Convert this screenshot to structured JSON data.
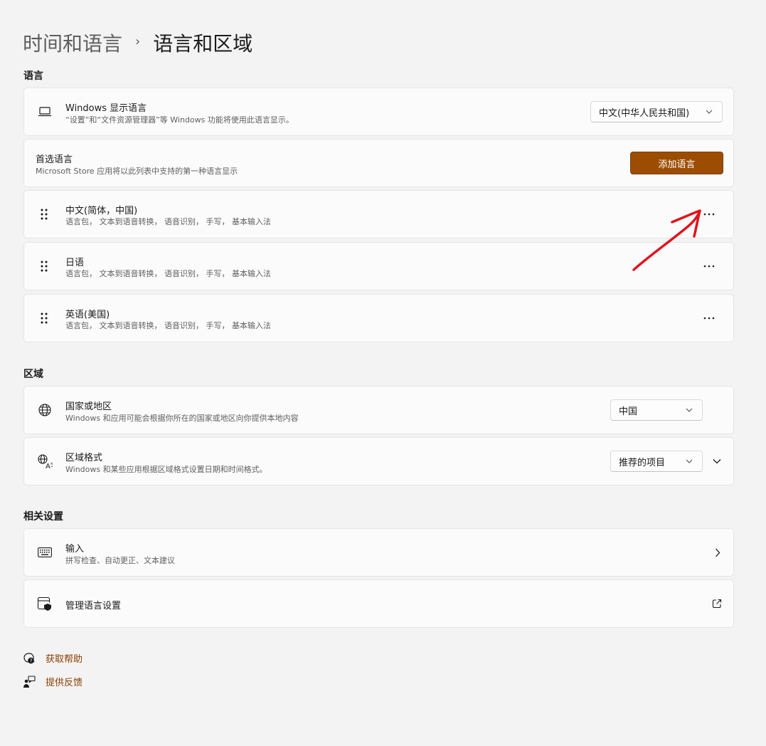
{
  "breadcrumb": {
    "parent": "时间和语言",
    "separator": "›",
    "current": "语言和区域"
  },
  "sections": {
    "language": "语言",
    "region": "区域",
    "related": "相关设置"
  },
  "windows_display_language": {
    "title": "Windows 显示语言",
    "desc": "“设置”和“文件资源管理器”等 Windows 功能将使用此语言显示。",
    "value": "中文(中华人民共和国)"
  },
  "preferred_languages": {
    "title": "首选语言",
    "desc": "Microsoft Store 应用将以此列表中支持的第一种语言显示",
    "add_button": "添加语言"
  },
  "languages": [
    {
      "name": "中文(简体，中国)",
      "features": "语言包， 文本到语音转换， 语音识别， 手写， 基本输入法"
    },
    {
      "name": "日语",
      "features": "语言包， 文本到语音转换， 语音识别， 手写， 基本输入法"
    },
    {
      "name": "英语(美国)",
      "features": "语言包， 文本到语音转换， 语音识别， 手写， 基本输入法"
    }
  ],
  "more_label": "···",
  "country": {
    "title": "国家或地区",
    "desc": "Windows 和应用可能会根据你所在的国家或地区向你提供本地内容",
    "value": "中国"
  },
  "regional_format": {
    "title": "区域格式",
    "desc": "Windows 和某些应用根据区域格式设置日期和时间格式。",
    "value": "推荐的项目"
  },
  "input": {
    "title": "输入",
    "desc": "拼写检查、自动更正、文本建议"
  },
  "admin_language": {
    "title": "管理语言设置"
  },
  "footer": {
    "help": "获取帮助",
    "feedback": "提供反馈"
  },
  "colors": {
    "accent": "#9c4d02",
    "link": "#8a3c00",
    "annotation": "#e0141e"
  },
  "icons": [
    "laptop-icon",
    "drag-handle-icon",
    "more-icon",
    "globe-icon",
    "language-format-icon",
    "keyboard-icon",
    "shield-window-icon",
    "external-link-icon",
    "chevron-right-icon",
    "chevron-down-icon",
    "help-icon",
    "feedback-icon"
  ]
}
